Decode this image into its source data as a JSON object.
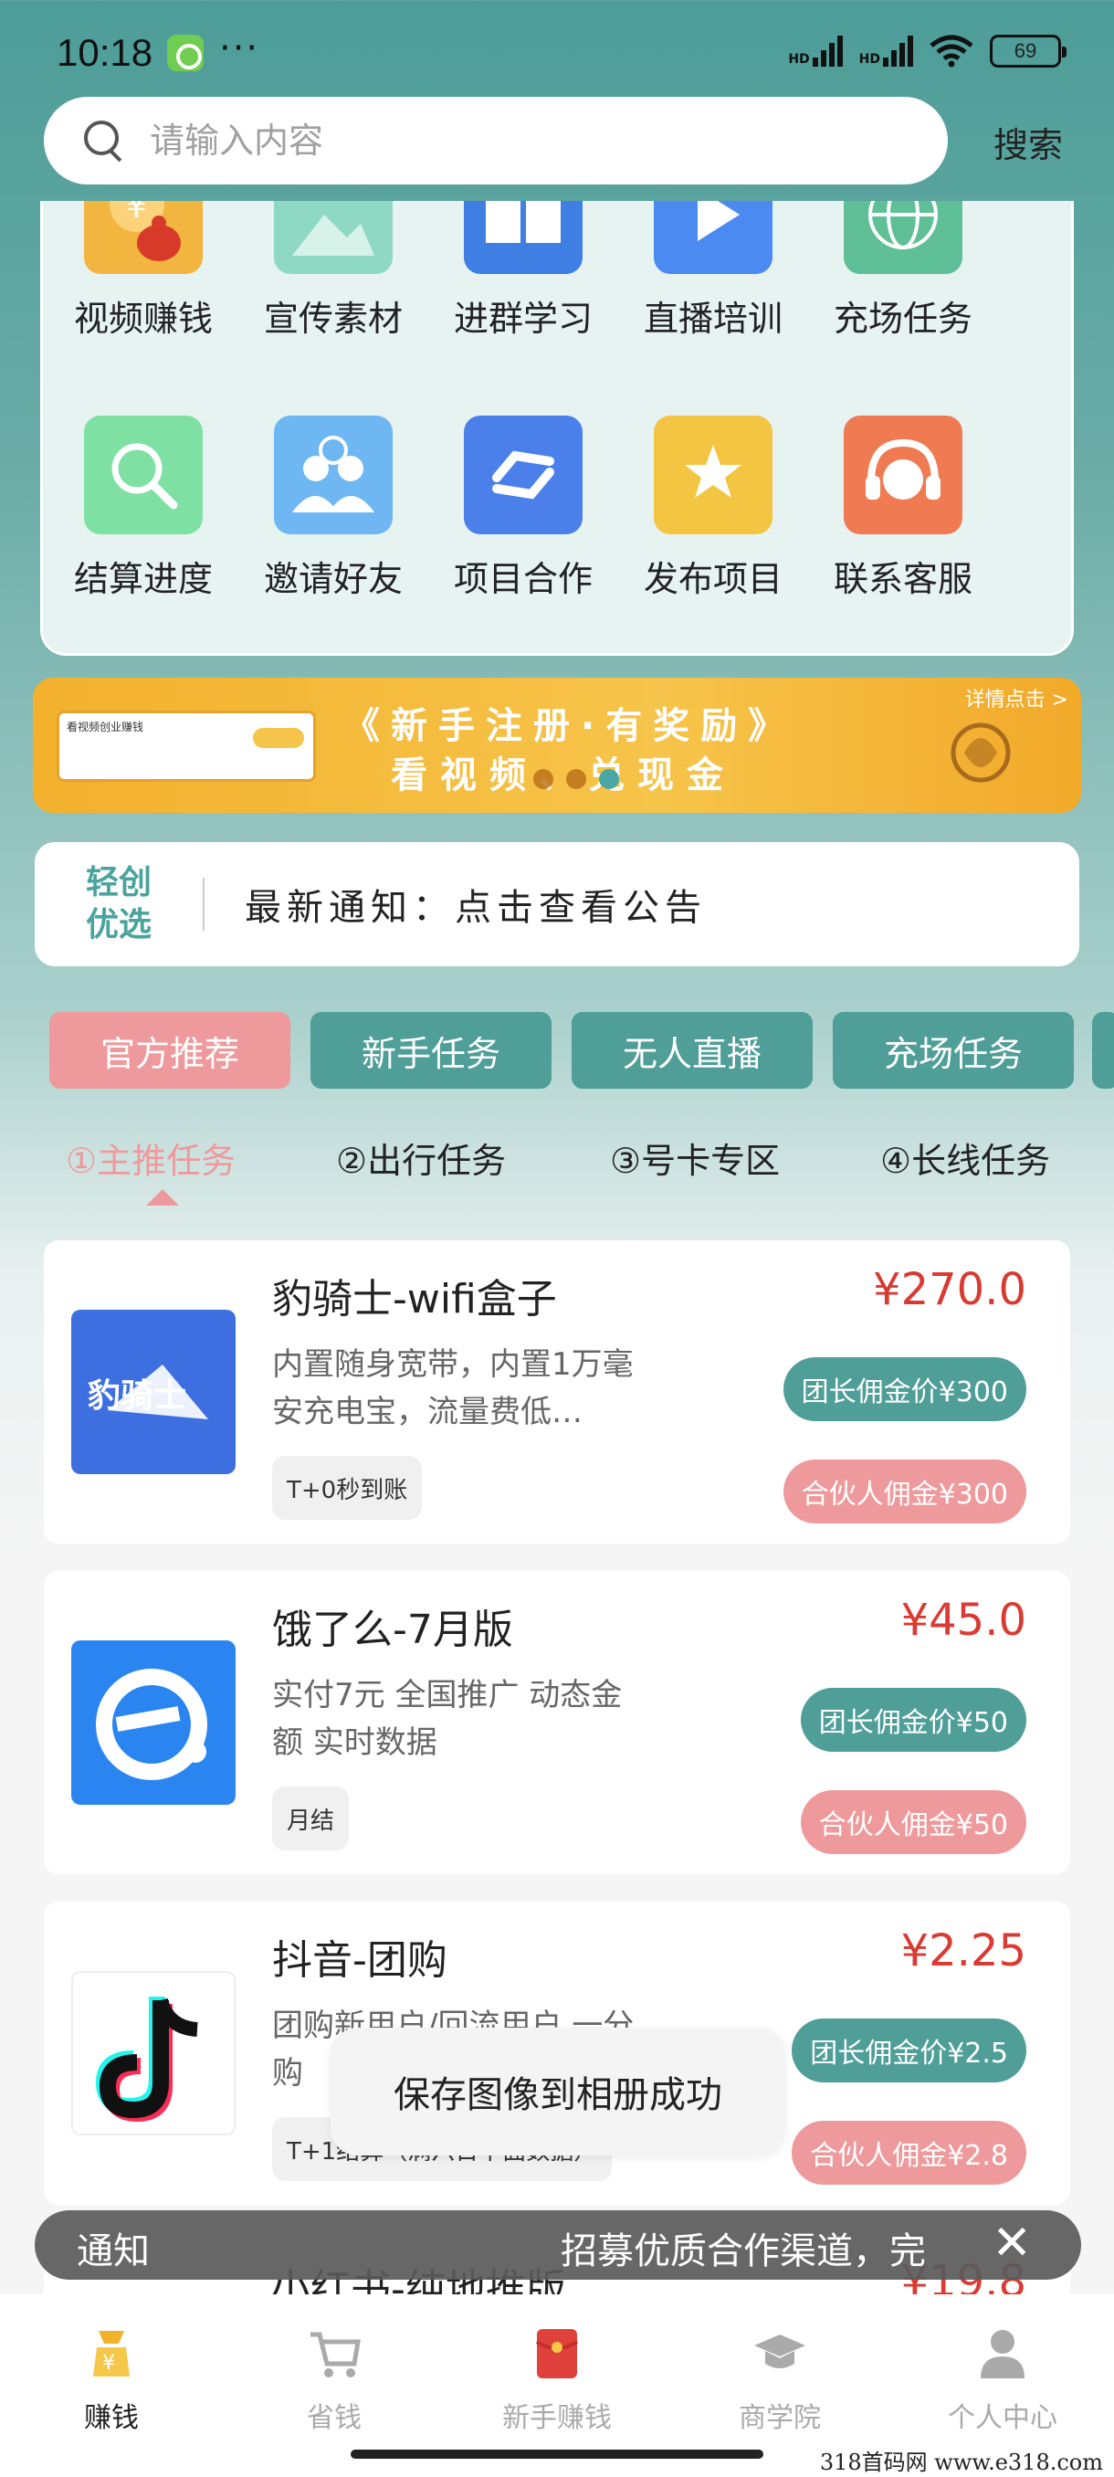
{
  "status_bar": {
    "time": "10:18",
    "dots": "···",
    "hd1": "HD",
    "hd2": "HD",
    "battery": "69"
  },
  "search": {
    "placeholder": "请输入内容",
    "button": "搜索"
  },
  "grid": [
    {
      "label": "视频赚钱",
      "icon": "coin-bag-icon",
      "color": "#f2b53f"
    },
    {
      "label": "宣传素材",
      "icon": "image-icon",
      "color": "#8fd8c4"
    },
    {
      "label": "进群学习",
      "icon": "book-icon",
      "color": "#3f7fe3"
    },
    {
      "label": "直播培训",
      "icon": "play-icon",
      "color": "#4b8af0"
    },
    {
      "label": "充场任务",
      "icon": "globe-lock-icon",
      "color": "#5fbf97"
    },
    {
      "label": "结算进度",
      "icon": "magnifier-icon",
      "color": "#7fe0a4"
    },
    {
      "label": "邀请好友",
      "icon": "users-icon",
      "color": "#6fb7f2"
    },
    {
      "label": "项目合作",
      "icon": "sync-icon",
      "color": "#4b80ea"
    },
    {
      "label": "发布项目",
      "icon": "star-bookmark-icon",
      "color": "#f4c542"
    },
    {
      "label": "联系客服",
      "icon": "headset-icon",
      "color": "#f07b52"
    }
  ],
  "banner": {
    "line1": "《新手注册·有奖励》",
    "line2": "看视频、兑现金",
    "detail": "详情点击 >",
    "mini_text": "看视频创业赚钱"
  },
  "notice": {
    "brand_line1": "轻创",
    "brand_line2": "优选",
    "text": "最新通知：点击查看公告"
  },
  "categories": [
    "官方推荐",
    "新手任务",
    "无人直播",
    "充场任务"
  ],
  "subtabs": [
    "①主推任务",
    "②出行任务",
    "③号卡专区",
    "④长线任务"
  ],
  "tasks": [
    {
      "title": "豹骑士-wifi盒子",
      "price": "¥270.0",
      "desc": "内置随身宽带，内置1万毫安充电宝，流量费低…",
      "tag": "T+0秒到账",
      "leader": "团长佣金价¥300",
      "partner": "合伙人佣金¥300",
      "logo_text": "豹骑士"
    },
    {
      "title": "饿了么-7月版",
      "price": "¥45.0",
      "desc": "实付7元 全国推广 动态金额 实时数据",
      "tag": "月结",
      "leader": "团长佣金价¥50",
      "partner": "合伙人佣金¥50",
      "logo_text": "e"
    },
    {
      "title": "抖音-团购",
      "price": "¥2.25",
      "desc": "团购新用户/回流用户 一分购",
      "tag": "T+1结算（满六日下面数据）",
      "leader": "团长佣金价¥2.5",
      "partner": "合伙人佣金¥2.8",
      "logo_text": "♪"
    }
  ],
  "peek": {
    "title": "小红书-纯地推版",
    "price": "¥19.8"
  },
  "toast": "保存图像到相册成功",
  "notification": {
    "label": "通知",
    "message": "招募优质合作渠道，完",
    "close": "✕"
  },
  "bottom_nav": [
    "赚钱",
    "省钱",
    "新手赚钱",
    "商学院",
    "个人中心"
  ],
  "watermark": "318首码网 www.e318.com"
}
